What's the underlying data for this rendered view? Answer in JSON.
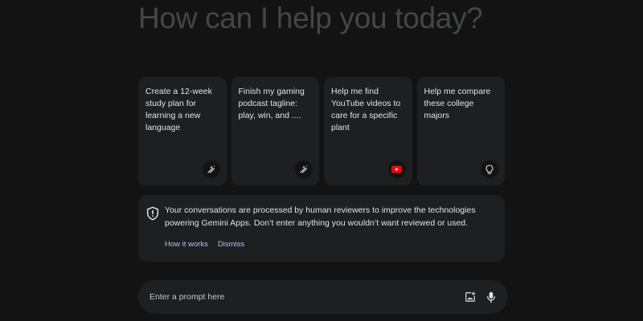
{
  "greeting": "How can I help you today?",
  "cards": [
    {
      "text": "Create a 12-week study plan for learning a new language",
      "icon": "pencil-sparkle-icon"
    },
    {
      "text": "Finish my gaming podcast tagline: play, win, and ....",
      "icon": "pencil-sparkle-icon"
    },
    {
      "text": "Help me find YouTube videos to care for a specific plant",
      "icon": "youtube-icon"
    },
    {
      "text": "Help me compare these college majors",
      "icon": "lightbulb-icon"
    }
  ],
  "notice": {
    "text": "Your conversations are processed by human reviewers to improve the technologies powering Gemini Apps. Don’t enter anything you wouldn’t want reviewed or used.",
    "how_it_works": "How it works",
    "dismiss": "Dismiss"
  },
  "prompt": {
    "placeholder": "Enter a prompt here",
    "value": ""
  },
  "colors": {
    "background": "#131314",
    "surface": "#1e1f20",
    "greeting": "#444746",
    "link": "#a8c7fa",
    "youtube": "#ff0000"
  }
}
